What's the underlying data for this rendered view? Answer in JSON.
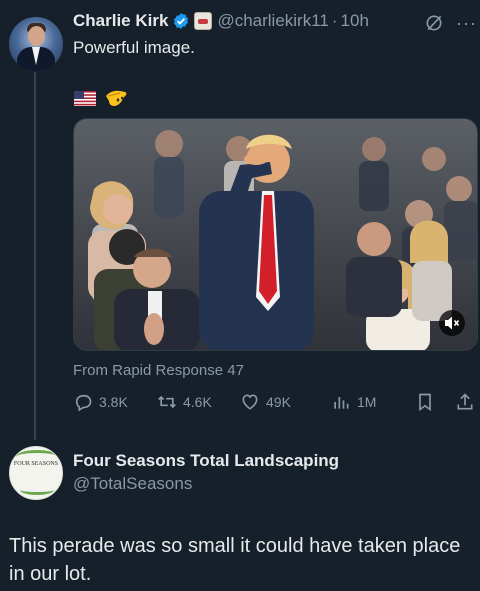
{
  "tweet": {
    "author": {
      "display_name": "Charlie Kirk",
      "handle": "@charliekirk11",
      "separator": "·",
      "time": "10h"
    },
    "text": "Powerful image.",
    "emojis": [
      "us-flag-icon",
      "salute-emoji-icon"
    ],
    "media": {
      "type": "video",
      "source": "From Rapid Response 47",
      "muted": true
    },
    "stats": {
      "replies": "3.8K",
      "retweets": "4.6K",
      "likes": "49K",
      "views": "1M"
    }
  },
  "reply": {
    "author": {
      "display_name": "Four Seasons Total Landscaping",
      "handle": "@TotalSeasons",
      "logo_text": "FOUR SEASONS"
    },
    "text": "This perade was so small it could have taken place in our lot."
  },
  "colors": {
    "background": "#15202b",
    "text_primary": "#e7e9ea",
    "text_secondary": "#8b98a5",
    "verified": "#1d9bf0",
    "thread_line": "#38444d"
  }
}
